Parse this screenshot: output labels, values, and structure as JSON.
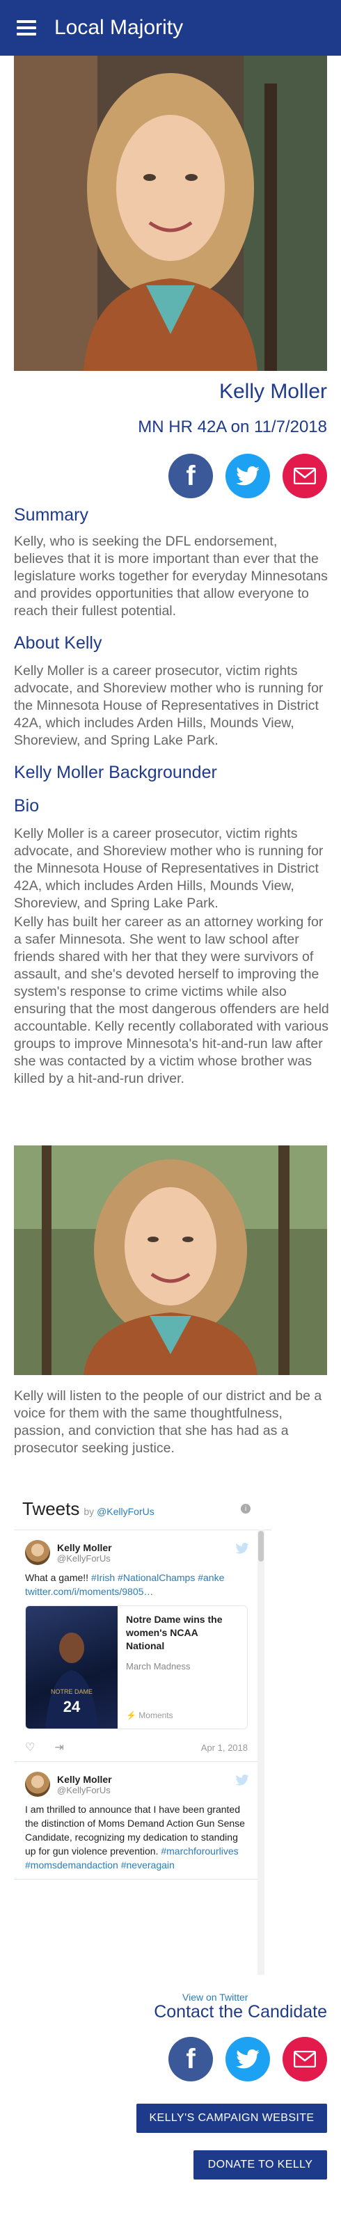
{
  "header": {
    "title": "Local Majority",
    "menu_icon": "hamburger-menu-icon"
  },
  "candidate": {
    "name": "Kelly Moller",
    "race": "MN HR 42A on 11/7/2018"
  },
  "social_icons": [
    "facebook-icon",
    "twitter-icon",
    "email-icon"
  ],
  "sections": {
    "summary_heading": "Summary",
    "summary_text": "Kelly, who is seeking the DFL endorsement, believes that it is more important than ever that the legislature works together for everyday Minnesotans and provides opportunities that allow everyone to reach their fullest potential.",
    "about_heading": "About Kelly",
    "about_text": "Kelly Moller is a career prosecutor, victim rights advocate, and Shoreview mother who is running for the Minnesota House of Representatives in District 42A, which includes Arden Hills, Mounds View, Shoreview, and Spring Lake Park.",
    "backgrounder_heading": "Kelly Moller Backgrounder",
    "bio_heading": "Bio",
    "bio_text_1": "Kelly Moller is a career prosecutor, victim rights advocate, and Shoreview mother who is running for the Minnesota House of Representatives in District 42A, which includes Arden Hills, Mounds View, Shoreview, and Spring Lake Park.",
    "bio_text_2": "Kelly has built her career as an attorney working for a safer Minnesota. She went to law school after friends shared with her that they were survivors of assault, and she's devoted herself to improving the system's response to crime victims while also ensuring that the most dangerous offenders are held accountable. Kelly recently collaborated with various groups to improve Minnesota's hit-and-run law after she was contacted by a victim whose brother was killed by a hit-and-run driver.",
    "closing_text": "Kelly will listen to the people of our district and be a voice for them with the same thoughtfulness, passion, and conviction that she has had as a prosecutor seeking justice."
  },
  "twitter": {
    "title": "Tweets",
    "by": "by",
    "by_handle": "@KellyForUs",
    "view_link": "View on Twitter",
    "tweets": [
      {
        "name": "Kelly Moller",
        "handle": "@KellyForUs",
        "text": "What a game!! ",
        "hashtags": "#Irish #NationalChamps #anke",
        "link": "twitter.com/i/moments/9805…",
        "card_title": "Notre Dame wins the women's NCAA National",
        "card_sub": "March Madness",
        "card_foot": "Moments",
        "card_jersey": "24",
        "card_brand": "NOTRE DAME",
        "date": "Apr 1, 2018"
      },
      {
        "name": "Kelly Moller",
        "handle": "@KellyForUs",
        "text": "I am thrilled to announce that I have been granted the distinction of Moms Demand Action Gun Sense Candidate, recognizing my dedication to standing up for gun violence prevention.",
        "hashtags": "#marchforourlives #momsdemandaction #neveragain"
      }
    ]
  },
  "contact": {
    "heading": "Contact the Candidate",
    "website_button": "KELLY'S CAMPAIGN WEBSITE",
    "donate_button": "DONATE TO KELLY"
  },
  "colors": {
    "primary": "#1e3a8a",
    "facebook": "#3b5998",
    "twitter": "#1da1f2",
    "email": "#e31b4c",
    "text_gray": "#666666",
    "link": "#2b7bb9"
  }
}
